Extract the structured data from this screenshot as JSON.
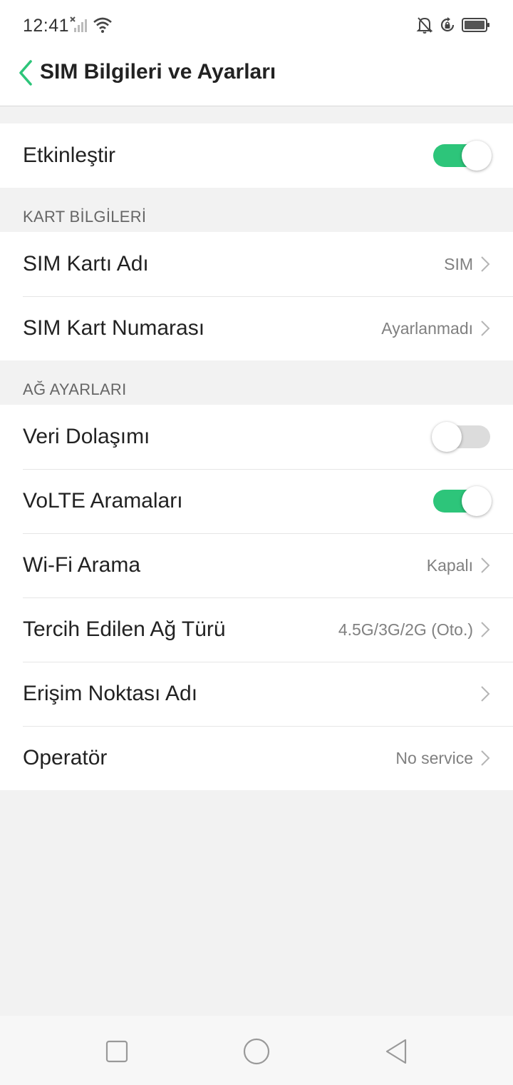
{
  "status_bar": {
    "time": "12:41",
    "icons": [
      "signal-off-icon",
      "wifi-icon",
      "bell-off-icon",
      "rotation-lock-icon",
      "battery-icon"
    ]
  },
  "header": {
    "title": "SIM Bilgileri ve Ayarları",
    "back_icon": "chevron-left-icon"
  },
  "colors": {
    "accent": "#2dc57a",
    "toggle_off": "#dcdcdc",
    "background": "#f2f2f2"
  },
  "enable": {
    "label": "Etkinleştir",
    "on": true
  },
  "card_info": {
    "section_title": "KART BİLGİLERİ",
    "items": [
      {
        "label": "SIM Kartı Adı",
        "value": "SIM"
      },
      {
        "label": "SIM Kart Numarası",
        "value": "Ayarlanmadı"
      }
    ]
  },
  "network": {
    "section_title": "AĞ AYARLARI",
    "roaming": {
      "label": "Veri Dolaşımı",
      "on": false
    },
    "volte": {
      "label": "VoLTE Aramaları",
      "on": true
    },
    "items": [
      {
        "label": "Wi-Fi Arama",
        "value": "Kapalı"
      },
      {
        "label": "Tercih Edilen Ağ Türü",
        "value": "4.5G/3G/2G (Oto.)"
      },
      {
        "label": "Erişim Noktası Adı",
        "value": ""
      },
      {
        "label": "Operatör",
        "value": "No service"
      }
    ]
  },
  "nav_bar": {
    "icons": [
      "square-icon",
      "circle-icon",
      "triangle-back-icon"
    ]
  }
}
